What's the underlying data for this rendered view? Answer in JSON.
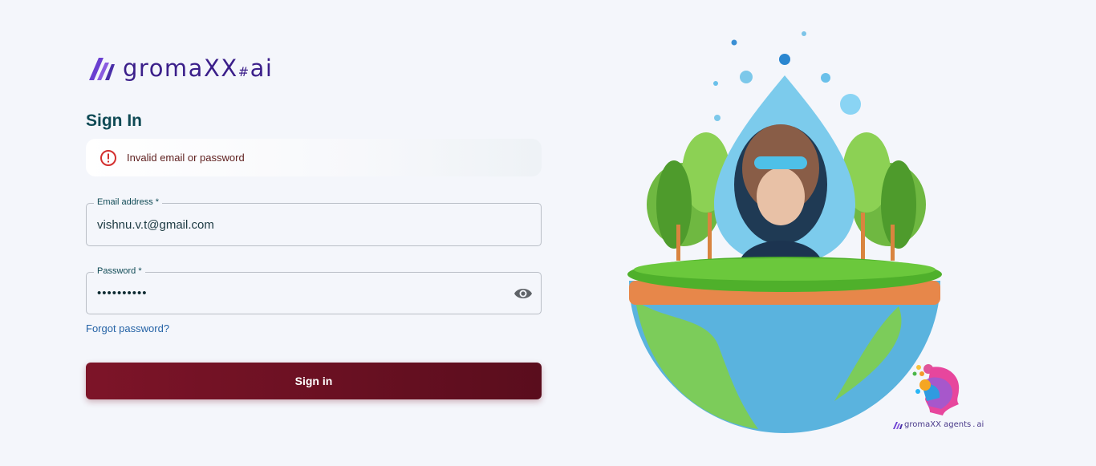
{
  "brand": {
    "name": "gromaXX",
    "suffix": "ai",
    "hash": "#"
  },
  "form": {
    "title": "Sign In",
    "alert_message": "Invalid email or password",
    "email_label": "Email address *",
    "email_value": "vishnu.v.t@gmail.com",
    "password_label": "Password *",
    "password_value": "••••••••••",
    "forgot_link": "Forgot password?",
    "submit_label": "Sign in"
  },
  "illustration": {
    "caption_name": "gromaXX agents",
    "caption_suffix": "ai"
  },
  "colors": {
    "primary": "#7d1428",
    "accent_teal": "#0f4a55",
    "brand_purple": "#3b1f8a",
    "error": "#d32f2f"
  },
  "icons": [
    "brand-logo-icon",
    "error-icon",
    "eye-icon",
    "head-logo-icon"
  ]
}
